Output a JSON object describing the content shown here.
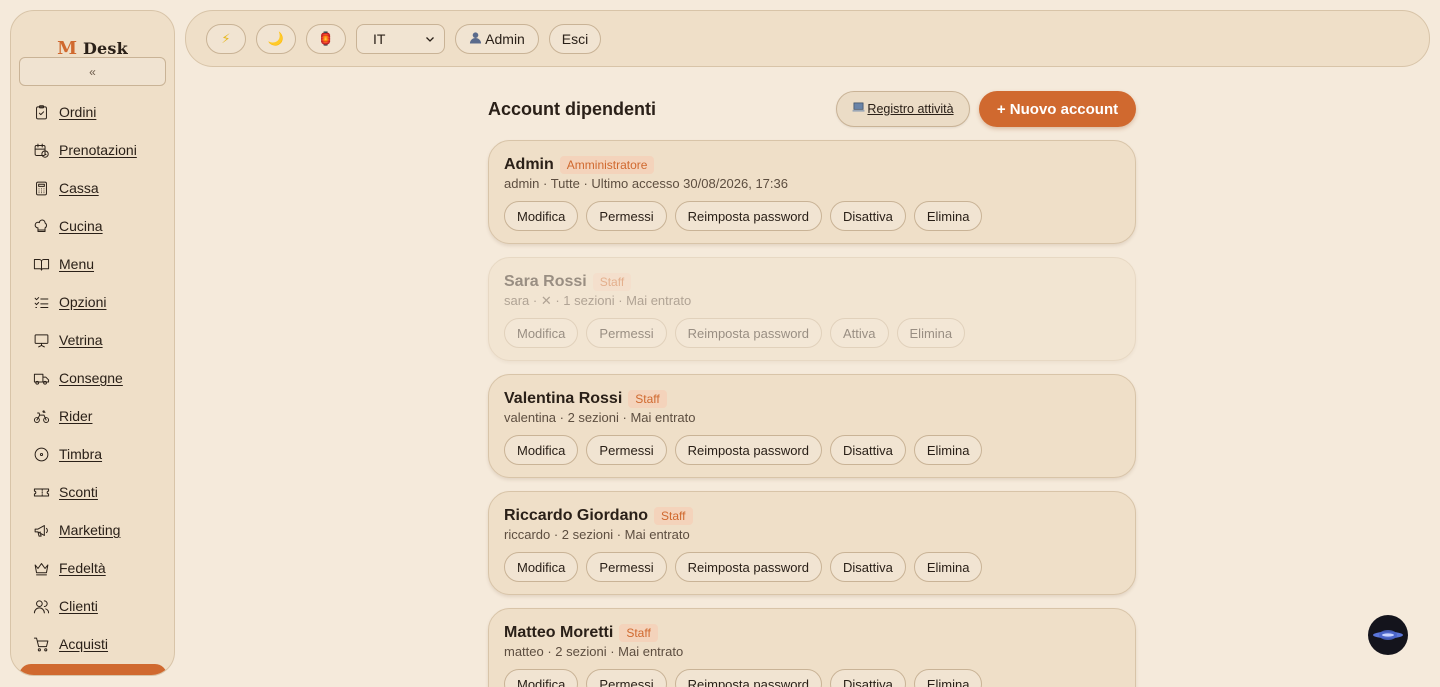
{
  "app": {
    "brand_m": "M",
    "brand_rest": "Desk",
    "collapse_label": "«"
  },
  "sidebar": {
    "items": [
      {
        "label": "Ordini",
        "icon": "clipboard-icon"
      },
      {
        "label": "Prenotazioni",
        "icon": "calendar-clock-icon"
      },
      {
        "label": "Cassa",
        "icon": "calculator-icon"
      },
      {
        "label": "Cucina",
        "icon": "chef-hat-icon"
      },
      {
        "label": "Menu",
        "icon": "book-icon"
      },
      {
        "label": "Opzioni",
        "icon": "checklist-icon"
      },
      {
        "label": "Vetrina",
        "icon": "presentation-icon"
      },
      {
        "label": "Consegne",
        "icon": "truck-icon"
      },
      {
        "label": "Rider",
        "icon": "bike-icon"
      },
      {
        "label": "Timbra",
        "icon": "clock-icon"
      },
      {
        "label": "Sconti",
        "icon": "ticket-icon"
      },
      {
        "label": "Marketing",
        "icon": "megaphone-icon"
      },
      {
        "label": "Fedeltà",
        "icon": "crown-icon"
      },
      {
        "label": "Clienti",
        "icon": "users-icon"
      },
      {
        "label": "Acquisti",
        "icon": "cart-icon"
      }
    ]
  },
  "topbar": {
    "bolt": "⚡",
    "moon": "🌙",
    "lantern": "🏮",
    "language": "IT",
    "user_label": "Admin",
    "logout_label": "Esci"
  },
  "page": {
    "title": "Account dipendenti",
    "log_button": "Registro attività",
    "new_button": "+ Nuovo account"
  },
  "accounts": [
    {
      "name": "Admin",
      "role": "Amministratore",
      "meta": "admin · Tutte · Ultimo accesso 30/08/2026, 17:36",
      "actions": [
        "Modifica",
        "Permessi",
        "Reimposta password",
        "Disattiva",
        "Elimina"
      ]
    },
    {
      "name": "Sara Rossi",
      "role": "Staff",
      "meta": "sara · ✕ · 1 sezioni · Mai entrato",
      "actions": [
        "Modifica",
        "Permessi",
        "Reimposta password",
        "Attiva",
        "Elimina"
      ]
    },
    {
      "name": "Valentina Rossi",
      "role": "Staff",
      "meta": "valentina · 2 sezioni · Mai entrato",
      "actions": [
        "Modifica",
        "Permessi",
        "Reimposta password",
        "Disattiva",
        "Elimina"
      ]
    },
    {
      "name": "Riccardo Giordano",
      "role": "Staff",
      "meta": "riccardo · 2 sezioni · Mai entrato",
      "actions": [
        "Modifica",
        "Permessi",
        "Reimposta password",
        "Disattiva",
        "Elimina"
      ]
    },
    {
      "name": "Matteo Moretti",
      "role": "Staff",
      "meta": "matteo · 2 sezioni · Mai entrato",
      "actions": [
        "Modifica",
        "Permessi",
        "Reimposta password",
        "Disattiva",
        "Elimina"
      ]
    }
  ],
  "colors": {
    "accent": "#d0692f",
    "background": "#f5eadb",
    "panel": "#efdfc8"
  }
}
